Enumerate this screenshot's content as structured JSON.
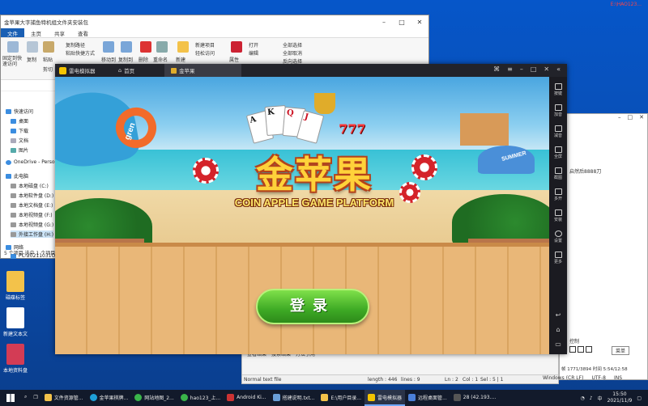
{
  "desktop": {
    "icons": [
      {
        "label": "磁碟标签"
      },
      {
        "label": "新建文本文"
      },
      {
        "label": "本地资料盘"
      }
    ],
    "corner_label": "E:\\HAO123..."
  },
  "explorer": {
    "title": "金苹果大字捕鱼特机组文件夹安装包",
    "tabs": [
      "文件",
      "主页",
      "共享",
      "查看"
    ],
    "ribbon": {
      "pin": "固定到快速访问",
      "copy": "复制",
      "paste": "粘贴",
      "copy_path": "复制路径",
      "paste_shortcut": "粘贴快捷方式",
      "cut": "剪切",
      "move_to": "移动到",
      "copy_to": "复制到",
      "delete": "删除",
      "rename": "重命名",
      "new_folder": "新建",
      "new_item": "新建项目",
      "easy_access": "轻松访问",
      "properties": "属性",
      "open": "打开",
      "edit": "编辑",
      "select_all": "全部选择",
      "select_none": "全部取消",
      "invert": "反向选择"
    },
    "nav": [
      {
        "label": "快速访问"
      },
      {
        "label": "桌面"
      },
      {
        "label": "下载"
      },
      {
        "label": "文档"
      },
      {
        "label": "图片"
      },
      {
        "label": "OneDrive - Perso"
      },
      {
        "label": "此电脑"
      },
      {
        "label": "本地磁盘 (C:)"
      },
      {
        "label": "本地软件盘 (D:)"
      },
      {
        "label": "本地文档盘 (E:)"
      },
      {
        "label": "本地视频盘 (F:)"
      },
      {
        "label": "本地视频盘 (G:)"
      },
      {
        "label": "外接工作盘 (H:)"
      },
      {
        "label": "网络"
      },
      {
        "label": "PC-20211031O"
      }
    ],
    "status": "5 个项目    选中 1 个项目"
  },
  "emulator": {
    "app_name": "雷电模拟器",
    "tabs": [
      {
        "label": "首页"
      },
      {
        "label": "金苹果"
      }
    ],
    "sidebar": [
      {
        "label": "按键"
      },
      {
        "label": "加音"
      },
      {
        "label": "减音"
      },
      {
        "label": "全屏"
      },
      {
        "label": "截图"
      },
      {
        "label": "多开"
      },
      {
        "label": "安装"
      },
      {
        "label": "设置"
      },
      {
        "label": "更多"
      }
    ]
  },
  "game": {
    "logo": "金苹果",
    "subtitle": "COIN APPLE GAME PLATFORM",
    "login_button": "登录",
    "ring_label": "gren",
    "umbrella_label": "SUMMER",
    "card_labels": [
      "A",
      "K",
      "Q",
      "J"
    ],
    "number_label": "777"
  },
  "right_window": {
    "text1": "启然后8888刀",
    "control_label": "控制",
    "menu_btn": "菜单",
    "meta": "帧  1771/3894  时间  5:54/12:58"
  },
  "editor": {
    "search": [
      "查看结果",
      "搜索结果",
      "方法引用"
    ],
    "status": {
      "type": "Normal text file",
      "length": "length : 446",
      "lines": "lines : 9",
      "ln": "Ln : 2",
      "col": "Col : 1",
      "sel": "Sel : 5 | 1",
      "eol": "Windows (CR LF)",
      "enc": "UTF-8",
      "ins": "INS"
    }
  },
  "taskbar": {
    "items": [
      {
        "label": "文件资源管..."
      },
      {
        "label": "金苹果棋牌..."
      },
      {
        "label": "网站地图_2..."
      },
      {
        "label": "hao123_上..."
      },
      {
        "label": "Android Ki..."
      },
      {
        "label": "搭建说明.txt..."
      },
      {
        "label": "E:\\用户目录..."
      },
      {
        "label": "雷电模拟器"
      },
      {
        "label": "远程桌面管..."
      },
      {
        "label": "28 (42.193...."
      }
    ],
    "time": "15:50",
    "date": "2021/11/9"
  }
}
